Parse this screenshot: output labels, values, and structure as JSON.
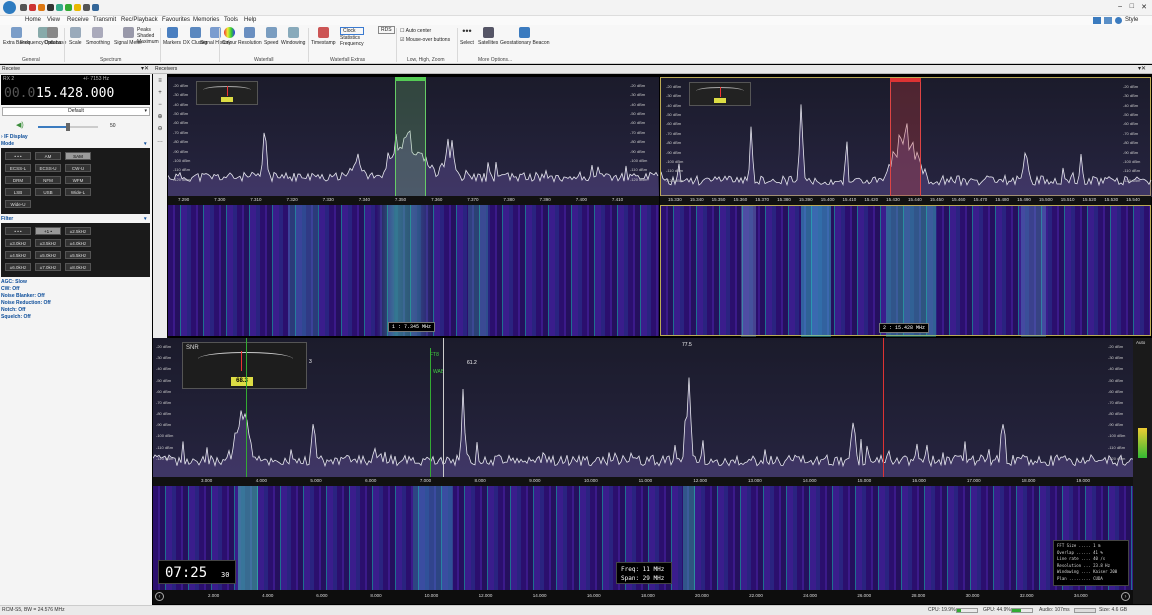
{
  "menu": [
    "Home",
    "View",
    "Receive",
    "Transmit",
    "Rec/Playback",
    "Favourites",
    "Memories",
    "Tools",
    "Help"
  ],
  "style_label": "Style",
  "ribbon": {
    "items": [
      [
        "Extra Bands",
        "Frequency Database",
        "Options"
      ],
      [
        "Scale",
        "Smoothing",
        "Signal Meter"
      ],
      [
        "Peaks",
        "Shaded",
        "Maximum"
      ],
      [
        "Markers",
        "DX Cluster",
        "Signal History"
      ],
      [
        "Colour",
        "Resolution",
        "Speed",
        "Windowing"
      ],
      [
        "Timestamp",
        "Clock",
        "Statistics",
        "Frequency"
      ],
      [
        "RDS",
        "Auto center",
        "Mouse-over buttons"
      ],
      [
        "Select",
        "Satellites",
        "Geostationary Beacon"
      ]
    ],
    "groups": [
      "General",
      "Spectrum",
      "Waterfall",
      "Waterfall Extras",
      "Low, High, Zoom",
      "More Options..."
    ]
  },
  "panes": {
    "left": "Receive",
    "right": "Receivers"
  },
  "receive": {
    "rx": "RX 2",
    "offset": "+/- 7153 Hz",
    "freq_dim": "00.0",
    "freq": "15.428.000",
    "preset": "Default",
    "volume": "50",
    "if_display": "IF Display",
    "mode_label": "Mode",
    "modes": [
      "• • •",
      "AM",
      "SAM",
      "ECSS-L",
      "ECSS-U",
      "CW-U",
      "DRM",
      "NFM",
      "WFM",
      "LSB",
      "USB",
      "Wide-L",
      "Wide-U"
    ],
    "filter_label": "Filter",
    "filters": [
      "• • •",
      "+1 •",
      "±2.5kHz",
      "±3.0kHz",
      "±3.5kHz",
      "±4.0kHz",
      "±4.5kHz",
      "±5.0kHz",
      "±5.5kHz",
      "±6.0kHz",
      "±7.0kHz",
      "±8.0kHz"
    ],
    "settings": [
      "AGC: Slow",
      "CW: Off",
      "Noise Blanker: Off",
      "Noise Reduction: Off",
      "Notch: Off",
      "Squelch: Off"
    ]
  },
  "rx1": {
    "ticks": [
      "7.290",
      "7.300",
      "7.310",
      "7.320",
      "7.330",
      "7.340",
      "7.350",
      "7.360",
      "7.370",
      "7.380",
      "7.390",
      "7.400",
      "7.410"
    ],
    "label": "1 : 7.345 MHz"
  },
  "rx2": {
    "ticks": [
      "15.330",
      "15.340",
      "15.350",
      "15.360",
      "15.370",
      "15.380",
      "15.390",
      "15.400",
      "15.410",
      "15.420",
      "15.430",
      "15.440",
      "15.450",
      "15.460",
      "15.470",
      "15.480",
      "15.490",
      "15.500",
      "15.510",
      "15.520",
      "15.530",
      "15.540"
    ],
    "label": "2 : 15.428 MHz"
  },
  "db_levels": [
    "-20 dBm",
    "-30 dBm",
    "-40 dBm",
    "-50 dBm",
    "-60 dBm",
    "-70 dBm",
    "-80 dBm",
    "-90 dBm",
    "-100 dBm",
    "-110 dBm",
    "-120 dBm"
  ],
  "wide": {
    "snr_label": "SNR",
    "snr_value": "68.3",
    "marker_a": "3",
    "marker_b": "77.5",
    "marker_c": "61.2",
    "ft8": "FT8",
    "wab": "WAB",
    "ticks": [
      "3.000",
      "4.000",
      "5.000",
      "6.000",
      "7.000",
      "8.000",
      "9.000",
      "10.000",
      "11.000",
      "12.000",
      "13.000",
      "14.000",
      "15.000",
      "16.000",
      "17.000",
      "18.000",
      "19.000"
    ],
    "bottom_ticks": [
      "2.000",
      "4.000",
      "6.000",
      "8.000",
      "10.000",
      "12.000",
      "14.000",
      "16.000",
      "18.000",
      "20.000",
      "22.000",
      "24.000",
      "26.000",
      "28.000",
      "30.000",
      "32.000",
      "34.000"
    ],
    "clock": "07:25",
    "clock_sec": "30",
    "freq_info": "Freq: 11 MHz",
    "span_info": "Span: 29 MHz",
    "stats": [
      "FFT Size ..... 1 m",
      "Overlap ...... 41 %",
      "Line rate .... 40 /s",
      "Resolution ... 23.8 Hz",
      "Windowing .... Kaiser 200",
      "Plan ......... CUDA"
    ],
    "auto": "Auto"
  },
  "status": {
    "left": "RCM-S5, BW = 24.576 MHz",
    "cpu": "CPU: 19.9%",
    "gpu": "GPU: 44.9%",
    "audio": "Audio: 107ms",
    "size": "Size: 4.6 GB"
  }
}
